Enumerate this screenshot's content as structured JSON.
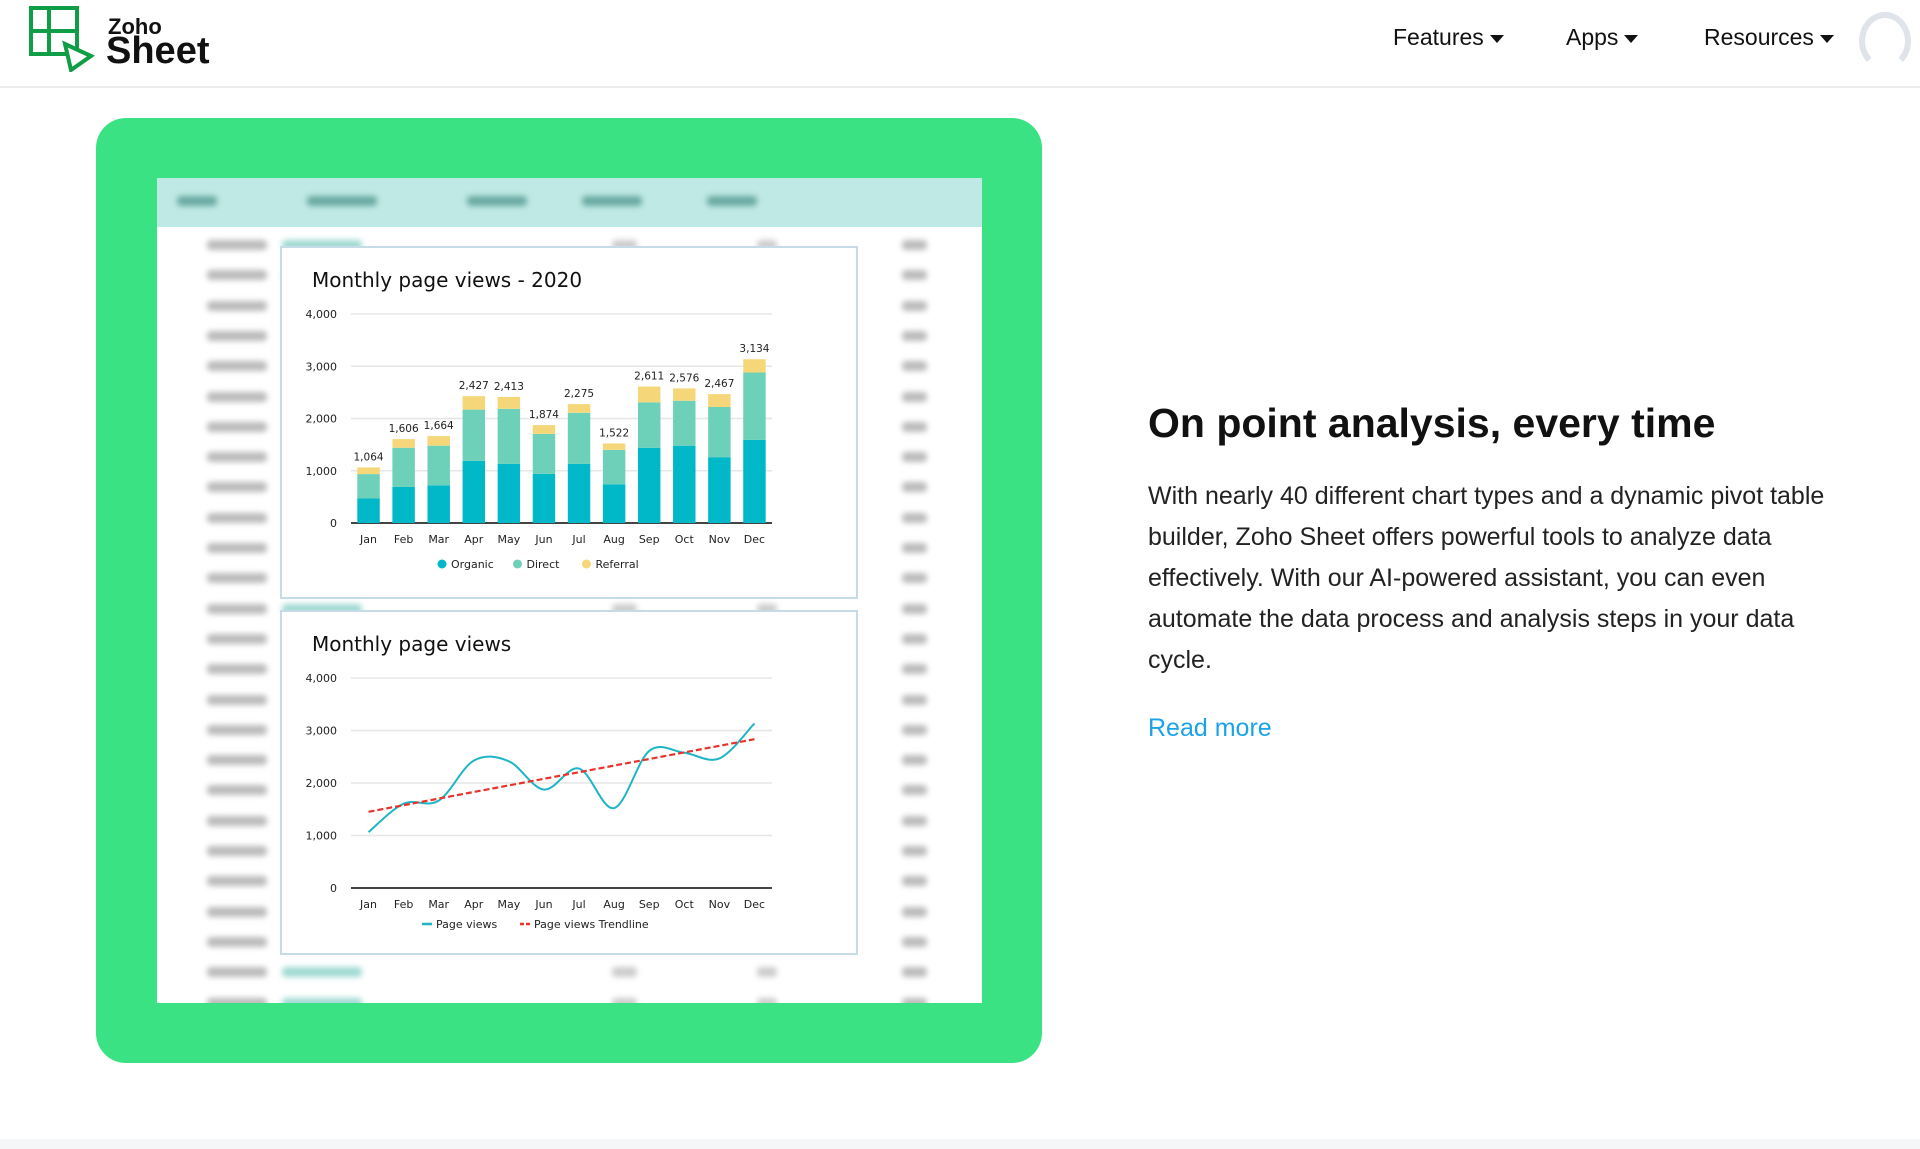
{
  "header": {
    "logo": {
      "brand": "Zoho",
      "product": "Sheet"
    },
    "nav": [
      {
        "label": "Features",
        "icon": "caret-down-icon"
      },
      {
        "label": "Apps",
        "icon": "caret-down-icon"
      },
      {
        "label": "Resources",
        "icon": "caret-down-icon"
      }
    ],
    "avatar_icon": "user-avatar-icon"
  },
  "section": {
    "heading": "On point analysis, every time",
    "paragraph": "With nearly 40 different chart types and a dynamic pivot table builder, Zoho Sheet offers powerful tools to analyze data effectively. With our AI-powered assistant, you can even automate the data process and analysis steps in your data cycle.",
    "read_more": "Read more",
    "link_color": "#1aa3e8",
    "card_color": "#3ae284"
  },
  "chart_data": [
    {
      "type": "bar",
      "stacked": true,
      "title": "Monthly page views - 2020",
      "categories": [
        "Jan",
        "Feb",
        "Mar",
        "Apr",
        "May",
        "Jun",
        "Jul",
        "Aug",
        "Sep",
        "Oct",
        "Nov",
        "Dec"
      ],
      "series": [
        {
          "name": "Organic",
          "color": "#00b8c8",
          "values": [
            470,
            690,
            720,
            1190,
            1130,
            940,
            1130,
            740,
            1440,
            1480,
            1260,
            1590
          ]
        },
        {
          "name": "Direct",
          "color": "#6dd0b8",
          "values": [
            466,
            750,
            760,
            980,
            1055,
            765,
            980,
            660,
            870,
            860,
            960,
            1290
          ]
        },
        {
          "name": "Referral",
          "color": "#f5d77a",
          "values": [
            128,
            166,
            184,
            257,
            228,
            169,
            165,
            122,
            301,
            236,
            247,
            254
          ]
        }
      ],
      "totals": [
        "1,064",
        "1,606",
        "1,664",
        "2,427",
        "2,413",
        "1,874",
        "2,275",
        "1,522",
        "2,611",
        "2,576",
        "2,467",
        "3,134"
      ],
      "yticks": [
        "0",
        "1,000",
        "2,000",
        "3,000",
        "4,000"
      ],
      "ylim": [
        0,
        4000
      ],
      "grid": true,
      "legend": "bottom"
    },
    {
      "type": "line",
      "title": "Monthly page views",
      "categories": [
        "Jan",
        "Feb",
        "Mar",
        "Apr",
        "May",
        "Jun",
        "Jul",
        "Aug",
        "Sep",
        "Oct",
        "Nov",
        "Dec"
      ],
      "series": [
        {
          "name": "Page views",
          "color": "#1fb5c6",
          "values": [
            1064,
            1606,
            1664,
            2427,
            2413,
            1874,
            2275,
            1522,
            2611,
            2576,
            2467,
            3134
          ]
        },
        {
          "name": "Page views Trendline",
          "color": "#e8322b",
          "dashed": true,
          "values": [
            1452,
            1578,
            1703,
            1829,
            1954,
            2080,
            2206,
            2331,
            2457,
            2582,
            2708,
            2834
          ]
        }
      ],
      "yticks": [
        "0",
        "1,000",
        "2,000",
        "3,000",
        "4,000"
      ],
      "ylim": [
        0,
        4000
      ],
      "grid": true,
      "legend": "bottom"
    }
  ]
}
